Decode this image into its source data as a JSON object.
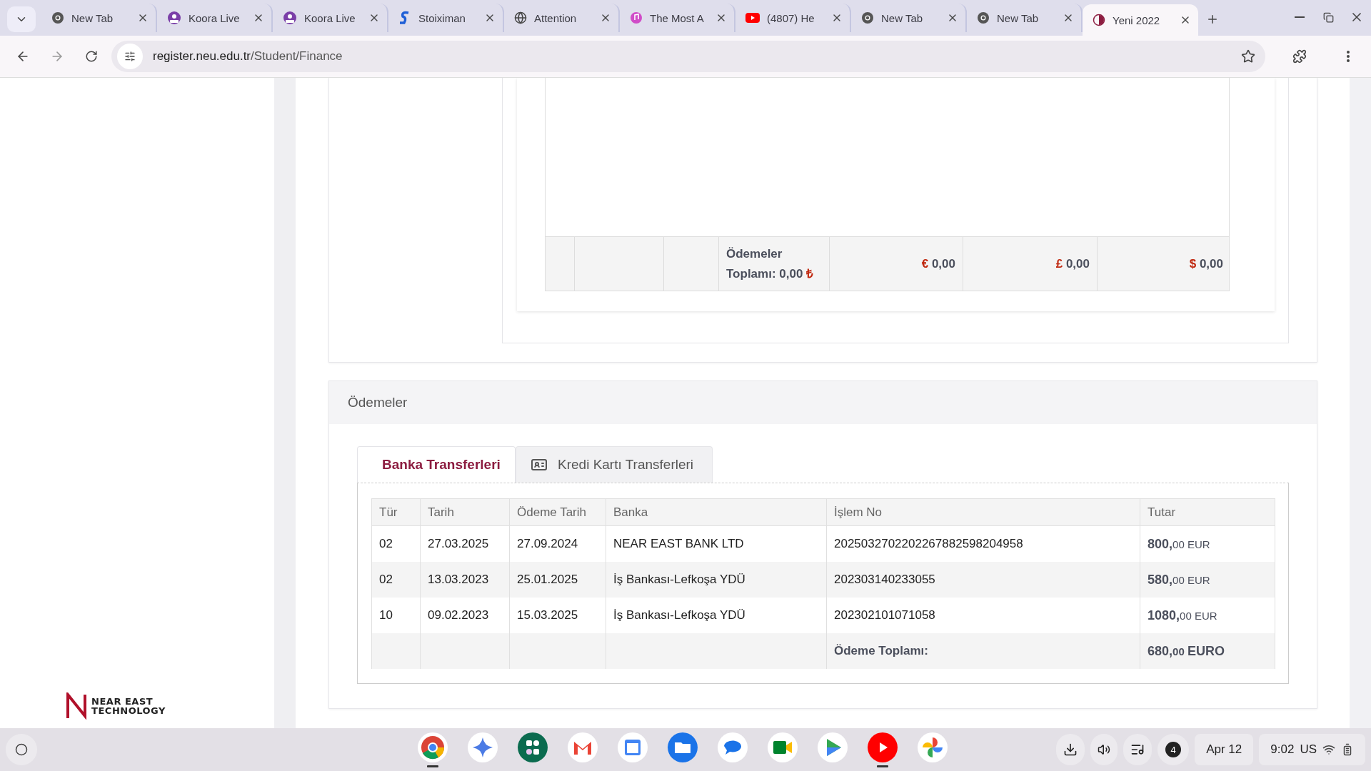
{
  "browser_tabs": [
    {
      "title": "New Tab",
      "kind": "chrome",
      "selected": false
    },
    {
      "title": "Koora Live",
      "kind": "koora",
      "selected": false
    },
    {
      "title": "Koora Live",
      "kind": "koora",
      "selected": false
    },
    {
      "title": "Stoiximan",
      "kind": "stoiximan",
      "selected": false
    },
    {
      "title": "Attention",
      "kind": "globe",
      "selected": false
    },
    {
      "title": "The Most A",
      "kind": "music",
      "selected": false
    },
    {
      "title": "(4807) He",
      "kind": "youtube",
      "selected": false
    },
    {
      "title": "New Tab",
      "kind": "chrome",
      "selected": false
    },
    {
      "title": "New Tab",
      "kind": "chrome",
      "selected": false
    },
    {
      "title": "Yeni 2022",
      "kind": "university",
      "selected": true
    }
  ],
  "address_bar": {
    "host": "register.neu.edu.tr",
    "path": "/Student/Finance"
  },
  "sidebar": {
    "logo": {
      "line_1": "NEAR EAST",
      "line_2": "TECHNOLOGY"
    }
  },
  "summary_table": {
    "footer": {
      "total_label": "Ödemeler Toplamı: 0,00",
      "total_symbol": "₺",
      "currencies": [
        {
          "symbol": "€",
          "amount": "0,00"
        },
        {
          "symbol": "£",
          "amount": "0,00"
        },
        {
          "symbol": "$",
          "amount": "0,00"
        }
      ]
    }
  },
  "payments": {
    "title": "Ödemeler",
    "tabs": [
      {
        "label": "Banka Transferleri",
        "icon": false,
        "selected": true
      },
      {
        "label": "Kredi Kartı Transferleri",
        "icon": true,
        "selected": false
      }
    ],
    "columns": [
      "Tür",
      "Tarih",
      "Ödeme Tarih",
      "Banka",
      "İşlem No",
      "Tutar"
    ],
    "rows": [
      [
        "02",
        "27.03.2025",
        "27.09.2024",
        "NEAR EAST BANK LTD",
        "2025032702202267882598204958",
        "**800,**00 EUR"
      ],
      [
        "02",
        "13.03.2023",
        "25.01.2025",
        "İş Bankası-Lefkoşa YDÜ",
        "202303140233055",
        "**580,**00 EUR"
      ],
      [
        "10",
        "09.02.2023",
        "15.03.2025",
        "İş Bankası-Lefkoşa YDÜ",
        "202302101071058",
        "**1080,**00 EUR"
      ]
    ],
    "total": {
      "label": "Ödeme Toplamı:",
      "amount": "**680,**00 **EURO**"
    }
  },
  "taskbar": {
    "apps": [
      {
        "kind": "chrome",
        "running": true
      },
      {
        "kind": "gemini",
        "running": false
      },
      {
        "kind": "launcher",
        "running": false
      },
      {
        "kind": "gmail",
        "running": false
      },
      {
        "kind": "calendar",
        "running": false
      },
      {
        "kind": "files",
        "running": false
      },
      {
        "kind": "messages",
        "running": false
      },
      {
        "kind": "meet",
        "running": false
      },
      {
        "kind": "play",
        "running": false
      },
      {
        "kind": "youtube",
        "running": true
      },
      {
        "kind": "photos",
        "running": false
      }
    ],
    "notification_count": "4",
    "date": "Apr 12",
    "time": "9:02",
    "keyboard": "US"
  }
}
